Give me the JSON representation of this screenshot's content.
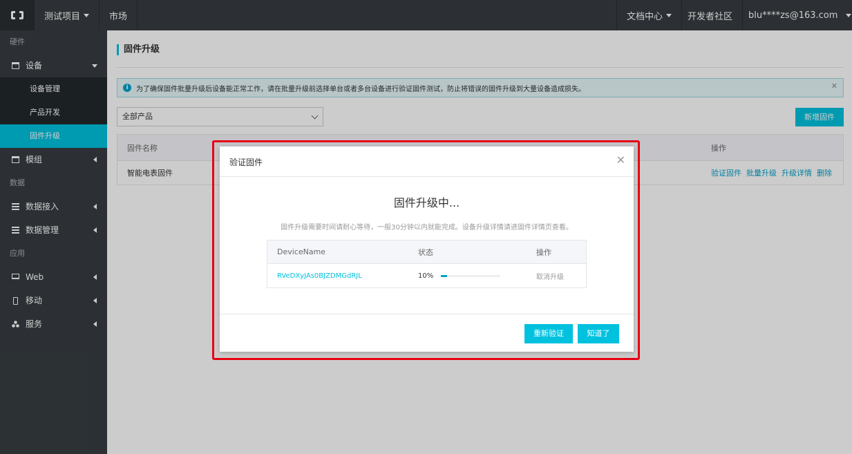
{
  "topbar": {
    "project": "测试项目",
    "market": "市场",
    "docs": "文档中心",
    "community": "开发者社区",
    "account": "blu****zs@163.com"
  },
  "sidebar": {
    "section_hardware": "硬件",
    "device": "设备",
    "device_mgmt": "设备管理",
    "product_dev": "产品开发",
    "firmware_upgrade": "固件升级",
    "module": "模组",
    "section_data": "数据",
    "data_access": "数据接入",
    "data_mgmt": "数据管理",
    "section_app": "应用",
    "web": "Web",
    "mobile": "移动",
    "service": "服务"
  },
  "main": {
    "title": "固件升级",
    "alert": "为了确保固件批量升级后设备能正常工作，请在批量升级前选择单台或者多台设备进行验证固件测试，防止将错误的固件升级到大量设备造成损失。",
    "select_value": "全部产品",
    "new_button": "新增固件",
    "table": {
      "col_name": "固件名称",
      "col_ops": "操作",
      "row_name": "智能电表固件",
      "ops": [
        "验证固件",
        "批量升级",
        "升级详情",
        "删除"
      ]
    }
  },
  "modal": {
    "title": "验证固件",
    "heading": "固件升级中...",
    "desc": "固件升级需要时间请耐心等待，一般30分钟以内就能完成。设备升级详情请进固件详情页查看。",
    "col_device": "DeviceName",
    "col_status": "状态",
    "col_ops": "操作",
    "device_name": "RVeDXyJAs0BJZDMGdRJL",
    "progress_label": "10%",
    "progress_value": 0.1,
    "cancel": "取消升级",
    "reverify_button": "重新验证",
    "ok_button": "知道了"
  },
  "colors": {
    "accent": "#00c1de",
    "topbar": "#373d41",
    "highlight": "#e60012"
  }
}
